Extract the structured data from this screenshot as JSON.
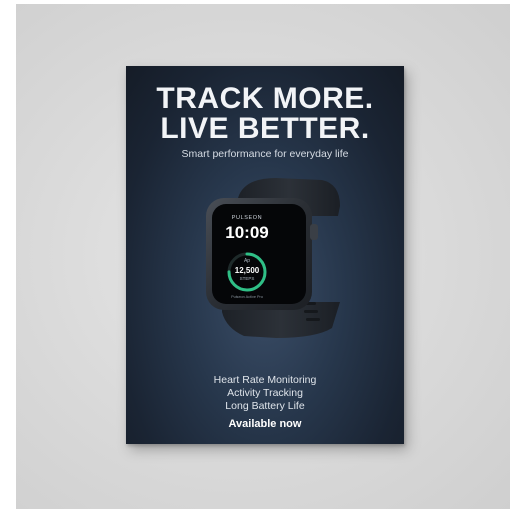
{
  "poster": {
    "headline_line1": "TRACK MORE.",
    "headline_line2": "LIVE BETTER.",
    "tagline": "Smart performance for everyday life",
    "features": [
      "Heart Rate Monitoring",
      "Activity Tracking",
      "Long Battery Life"
    ],
    "cta": "Available now"
  },
  "watch_screen": {
    "brand": "PULSEON",
    "time": "10:09",
    "ring_label": "Ap",
    "steps_value": "12,500",
    "steps_unit": "STEPS",
    "model_name": "Pulseon Active Pro",
    "ring_progress": 0.75
  },
  "colors": {
    "poster_bg": "#1a2433",
    "ring_accent": "#2fbf86",
    "text_light": "#f2f4f7"
  }
}
